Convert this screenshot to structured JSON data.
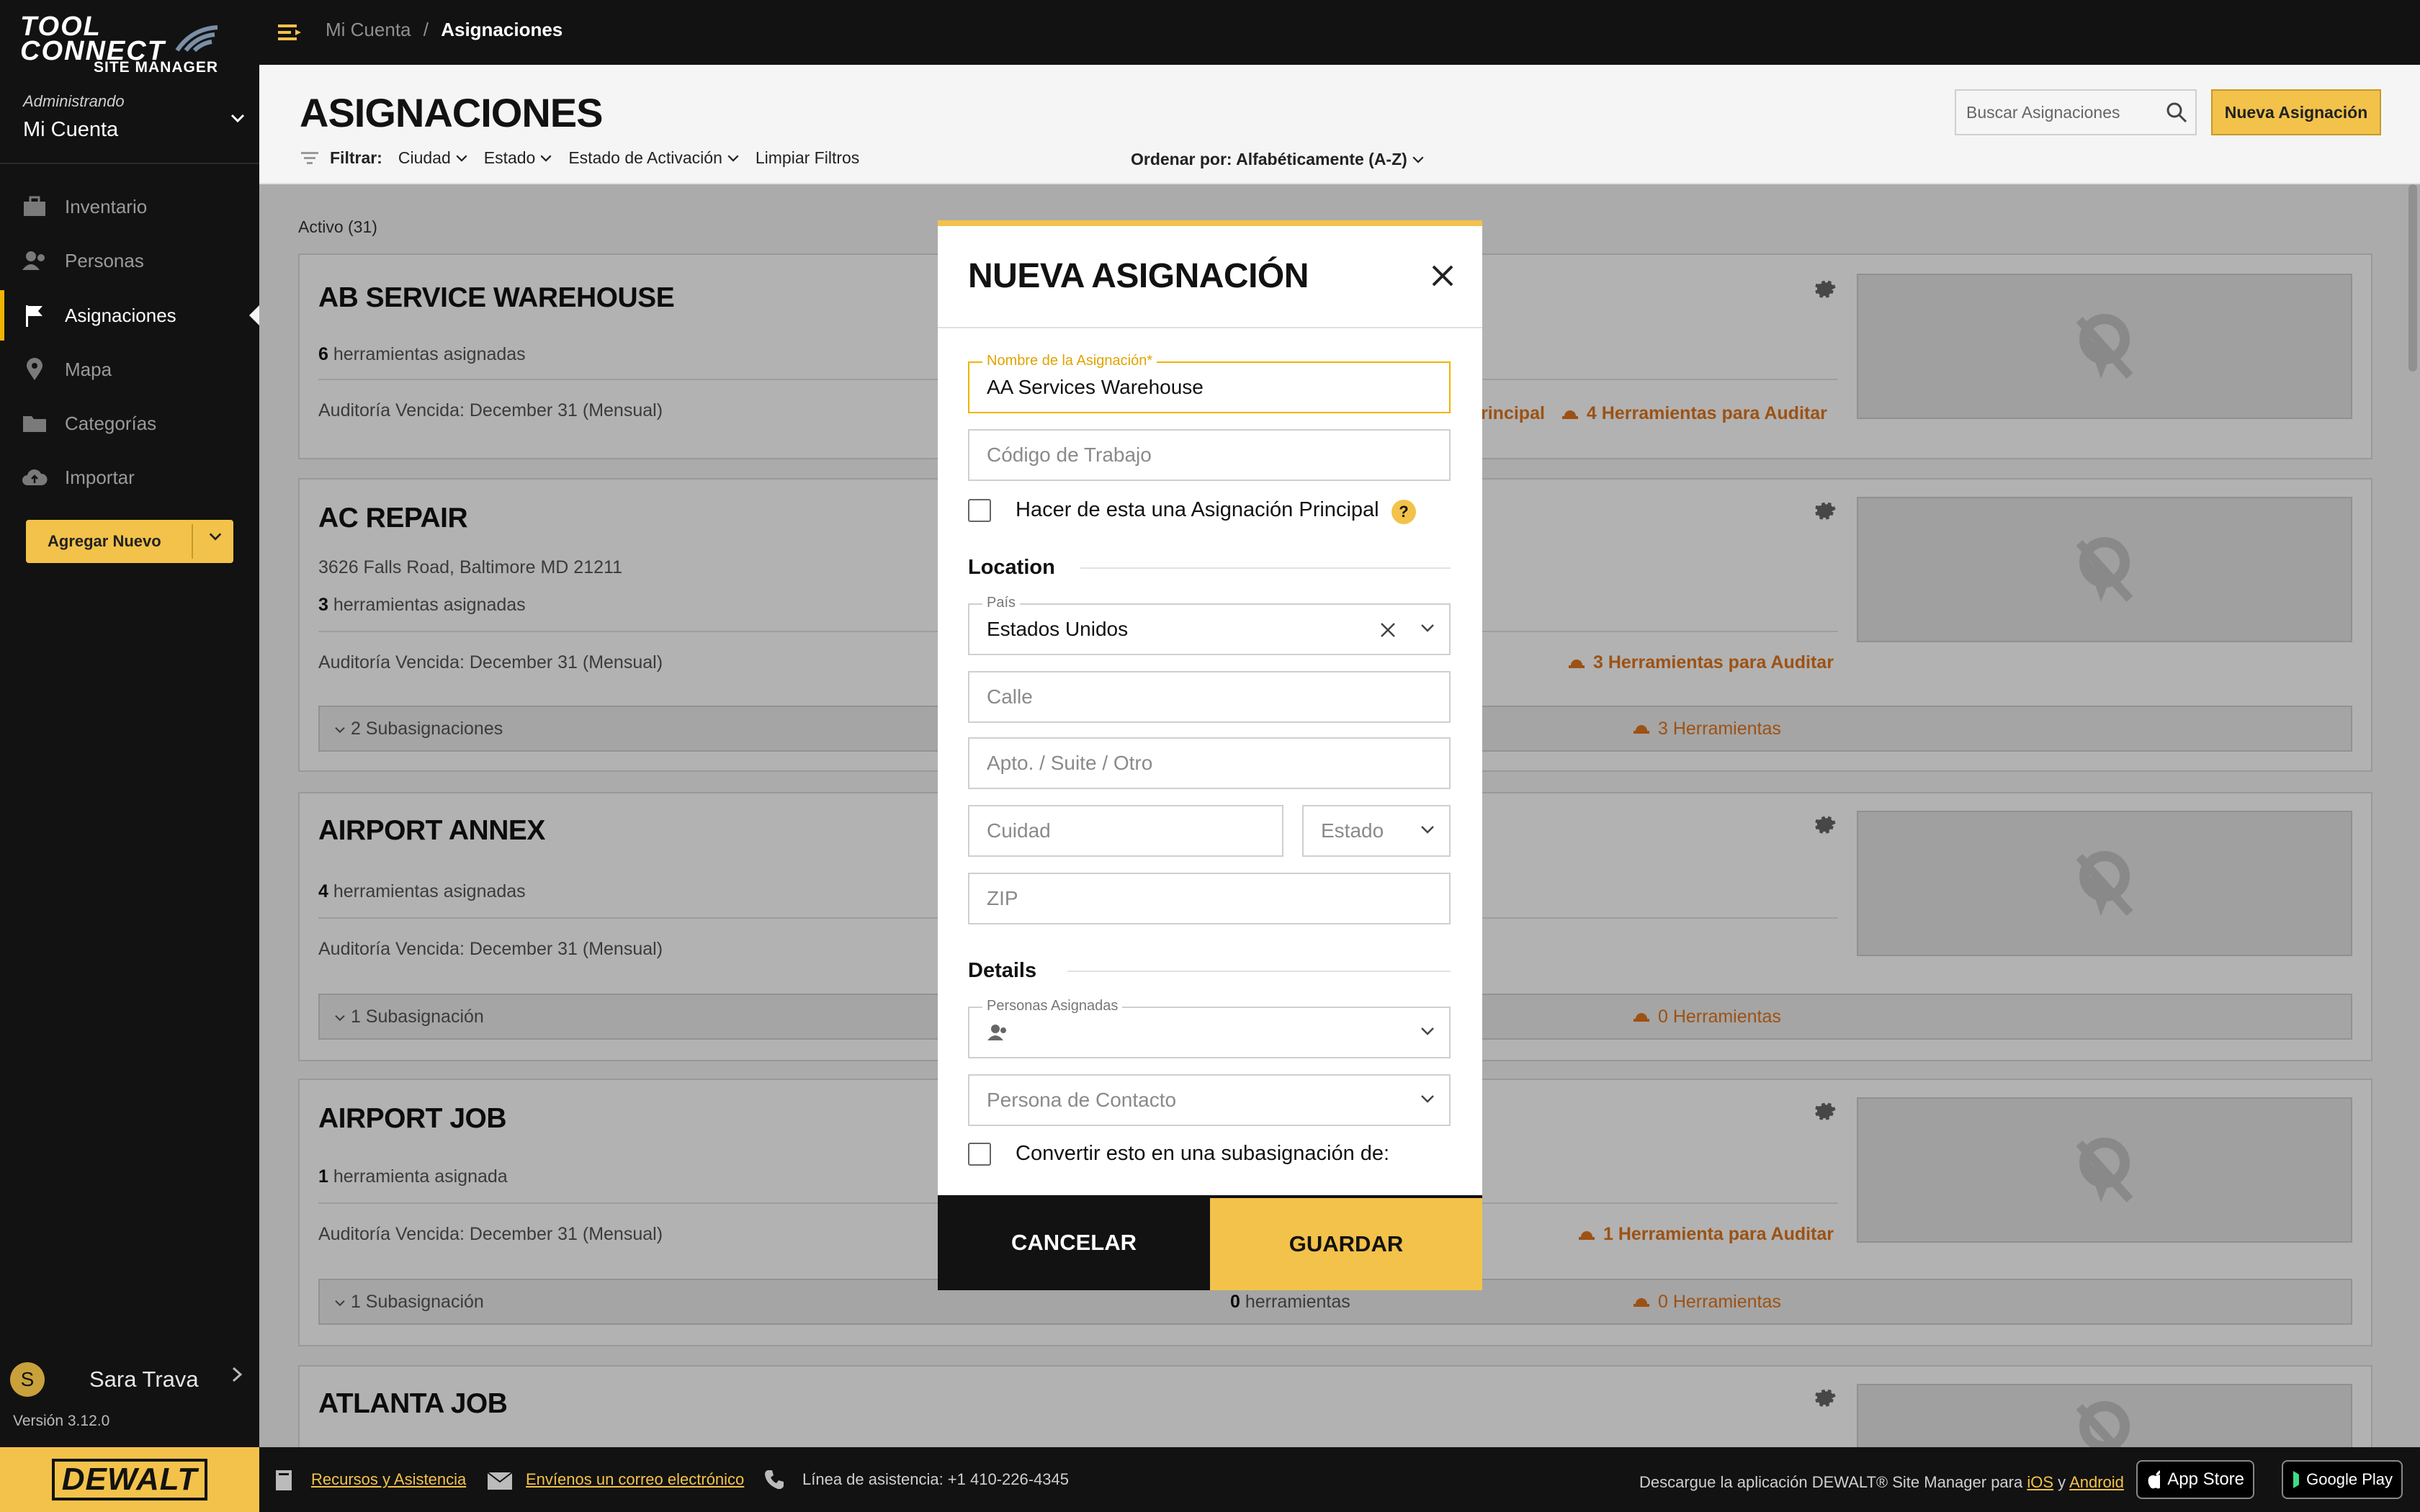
{
  "logo": {
    "line1": "TOOL",
    "line2": "CONNECT",
    "line3": "SITE MANAGER"
  },
  "sidebar": {
    "admin_label": "Administrando",
    "account": "Mi Cuenta",
    "items": [
      {
        "label": "Inventario",
        "icon": "toolbox-icon"
      },
      {
        "label": "Personas",
        "icon": "people-icon"
      },
      {
        "label": "Asignaciones",
        "icon": "flag-icon",
        "active": true
      },
      {
        "label": "Mapa",
        "icon": "map-pin-icon"
      },
      {
        "label": "Categorías",
        "icon": "folder-icon"
      },
      {
        "label": "Importar",
        "icon": "cloud-upload-icon"
      }
    ],
    "add_new": "Agregar Nuevo",
    "user_initial": "S",
    "user_name": "Sara Trava",
    "version": "Versión 3.12.0"
  },
  "topbar": {
    "crumb_root": "Mi Cuenta",
    "crumb_sep": "/",
    "crumb_current": "Asignaciones"
  },
  "header": {
    "title": "ASIGNACIONES",
    "filter_label": "Filtrar:",
    "filters": [
      "Ciudad",
      "Estado",
      "Estado de Activación"
    ],
    "clear_filters": "Limpiar Filtros",
    "sort": "Ordenar por: Alfabéticamente (A-Z)",
    "search_placeholder": "Buscar Asignaciones",
    "new_button": "Nueva Asignación"
  },
  "content": {
    "active_count": "Activo (31)",
    "cards": [
      {
        "name": "AB SERVICE WAREHOUSE",
        "tools_count": "6",
        "tools_label": "herramientas asignadas",
        "audit": "Auditoría Vencida: December 31 (Mensual)",
        "audit_right_prefix": "rincipal",
        "audit_right": "4 Herramientas para Auditar"
      },
      {
        "name": "AC REPAIR",
        "address": "3626 Falls Road, Baltimore MD 21211",
        "tools_count": "3",
        "tools_label": "herramientas asignadas",
        "audit": "Auditoría Vencida: December 31 (Mensual)",
        "audit_right": "3 Herramientas para Auditar",
        "sub": "2 Subasignaciones",
        "sub_right": "3 Herramientas"
      },
      {
        "name": "AIRPORT ANNEX",
        "tools_count": "4",
        "tools_label": "herramientas asignadas",
        "audit": "Auditoría Vencida: December 31 (Mensual)",
        "sub": "1 Subasignación",
        "sub_right": "0 Herramientas"
      },
      {
        "name": "AIRPORT JOB",
        "tools_count": "1",
        "tools_label": "herramienta asignada",
        "audit": "Auditoría Vencida: December 31 (Mensual)",
        "audit_right": "1 Herramienta para Auditar",
        "sub": "1 Subasignación",
        "sub_mid_count": "0",
        "sub_mid": "herramientas",
        "sub_right": "0 Herramientas"
      },
      {
        "name": "ATLANTA JOB"
      }
    ]
  },
  "modal": {
    "title": "NUEVA ASIGNACIÓN",
    "name_label": "Nombre de la Asignación*",
    "name_value": "AA Services Warehouse",
    "job_code_placeholder": "Código de Trabajo",
    "principal_checkbox": "Hacer de esta una Asignación Principal",
    "help": "?",
    "location_heading": "Location",
    "country_label": "País",
    "country_value": "Estados Unidos",
    "street_placeholder": "Calle",
    "apt_placeholder": "Apto. / Suite / Otro",
    "city_placeholder": "Cuidad",
    "state_placeholder": "Estado",
    "zip_placeholder": "ZIP",
    "details_heading": "Details",
    "people_label": "Personas Asignadas",
    "contact_placeholder": "Persona de Contacto",
    "sub_checkbox": "Convertir esto en una subasignación de:",
    "cancel": "CANCELAR",
    "save": "GUARDAR"
  },
  "footer": {
    "brand": "DEWALT",
    "resources": "Recursos y Asistencia",
    "email": "Envíenos un correo electrónico",
    "phone": "Línea de asistencia: +1 410-226-4345",
    "download_text": "Descargue la aplicación DEWALT® Site Manager para",
    "ios": "iOS",
    "and": "y",
    "android": "Android",
    "appstore": "App Store",
    "googleplay": "Google Play"
  },
  "colors": {
    "accent": "#f3c24a",
    "audit_orange": "#e0761e",
    "dark": "#121212"
  }
}
